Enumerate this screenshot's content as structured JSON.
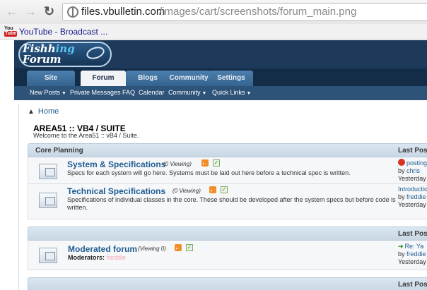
{
  "browser": {
    "url_host": "files.vbulletin.com",
    "url_path": "/images/cart/screenshots/forum_main.png",
    "bookmark": {
      "icon_you": "You",
      "icon_tube": "Tube",
      "label": "YouTube - Broadcast ..."
    }
  },
  "site": {
    "logo_main": "Fishh",
    "logo_accent": "ing",
    "logo_line2": "Forum",
    "tabs": [
      "Site",
      "Forum",
      "Blogs",
      "Community",
      "Settings"
    ],
    "subnav": [
      {
        "label": "New Posts",
        "dropdown": true
      },
      {
        "label": "Private Messages",
        "dropdown": false
      },
      {
        "label": "FAQ",
        "dropdown": false
      },
      {
        "label": "Calendar",
        "dropdown": false
      },
      {
        "label": "Community",
        "dropdown": true
      },
      {
        "label": "Quick Links",
        "dropdown": true
      }
    ]
  },
  "page": {
    "home": "Home",
    "title": "AREA51 :: VB4 / SUITE",
    "subtitle": "Welcome to the Area51 :: vB4 / Suite."
  },
  "categories": [
    {
      "name": "Core Planning",
      "last_post_header": "Last Post"
    },
    {
      "name": "",
      "last_post_header": "Last Post"
    },
    {
      "name": "",
      "last_post_header": "Last Post"
    }
  ],
  "forums": [
    {
      "title": "System & Specifications",
      "viewing": "(0 Viewing)",
      "description": "Specs for each system will go here. Systems must be laid out here before a technical spec is written.",
      "last_post": {
        "title": "posting",
        "by": "by",
        "user": "chris",
        "date": "Yesterday"
      }
    },
    {
      "title": "Technical Specifications",
      "viewing": "(0 Viewing)",
      "description": "Specifications of individual classes in the core. These should be developed after the system specs but before code is written.",
      "last_post": {
        "title": "Introduction",
        "by": "by",
        "user": "freddie",
        "date": "Yesterday"
      }
    },
    {
      "title": "Moderated forum",
      "viewing": "(Viewing 0)",
      "moderators_label": "Moderators:",
      "moderators": "freddie",
      "last_post": {
        "title": "Re: Ya",
        "by": "by",
        "user": "freddie",
        "date": "Yesterday"
      }
    }
  ],
  "icons": {
    "back": "arrow-left-icon",
    "forward": "arrow-right-icon",
    "reload": "reload-icon",
    "rss": "rss-icon",
    "subscribe": "checkmark-icon",
    "forum": "forum-folder-icon"
  },
  "colors": {
    "header": "#1e3a5a",
    "tab": "#4c7fae",
    "subnav": "#2e5379",
    "link": "#1f5d91",
    "category_head": "#dbe6f0"
  }
}
